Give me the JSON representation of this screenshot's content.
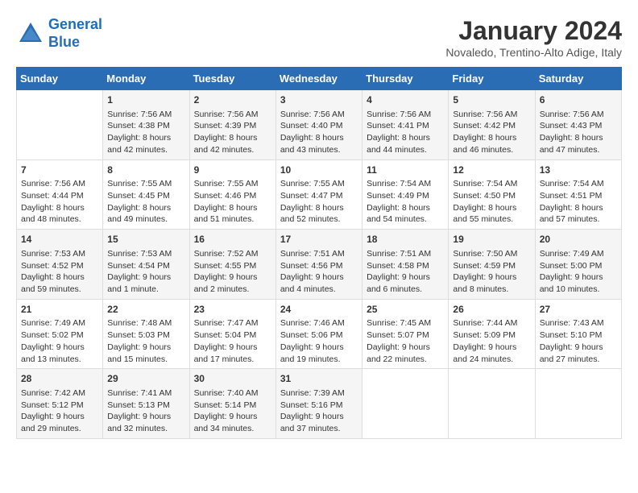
{
  "header": {
    "logo_line1": "General",
    "logo_line2": "Blue",
    "month_year": "January 2024",
    "location": "Novaledo, Trentino-Alto Adige, Italy"
  },
  "days_of_week": [
    "Sunday",
    "Monday",
    "Tuesday",
    "Wednesday",
    "Thursday",
    "Friday",
    "Saturday"
  ],
  "weeks": [
    [
      {
        "day": "",
        "sunrise": "",
        "sunset": "",
        "daylight": ""
      },
      {
        "day": "1",
        "sunrise": "Sunrise: 7:56 AM",
        "sunset": "Sunset: 4:38 PM",
        "daylight": "Daylight: 8 hours and 42 minutes."
      },
      {
        "day": "2",
        "sunrise": "Sunrise: 7:56 AM",
        "sunset": "Sunset: 4:39 PM",
        "daylight": "Daylight: 8 hours and 42 minutes."
      },
      {
        "day": "3",
        "sunrise": "Sunrise: 7:56 AM",
        "sunset": "Sunset: 4:40 PM",
        "daylight": "Daylight: 8 hours and 43 minutes."
      },
      {
        "day": "4",
        "sunrise": "Sunrise: 7:56 AM",
        "sunset": "Sunset: 4:41 PM",
        "daylight": "Daylight: 8 hours and 44 minutes."
      },
      {
        "day": "5",
        "sunrise": "Sunrise: 7:56 AM",
        "sunset": "Sunset: 4:42 PM",
        "daylight": "Daylight: 8 hours and 46 minutes."
      },
      {
        "day": "6",
        "sunrise": "Sunrise: 7:56 AM",
        "sunset": "Sunset: 4:43 PM",
        "daylight": "Daylight: 8 hours and 47 minutes."
      }
    ],
    [
      {
        "day": "7",
        "sunrise": "Sunrise: 7:56 AM",
        "sunset": "Sunset: 4:44 PM",
        "daylight": "Daylight: 8 hours and 48 minutes."
      },
      {
        "day": "8",
        "sunrise": "Sunrise: 7:55 AM",
        "sunset": "Sunset: 4:45 PM",
        "daylight": "Daylight: 8 hours and 49 minutes."
      },
      {
        "day": "9",
        "sunrise": "Sunrise: 7:55 AM",
        "sunset": "Sunset: 4:46 PM",
        "daylight": "Daylight: 8 hours and 51 minutes."
      },
      {
        "day": "10",
        "sunrise": "Sunrise: 7:55 AM",
        "sunset": "Sunset: 4:47 PM",
        "daylight": "Daylight: 8 hours and 52 minutes."
      },
      {
        "day": "11",
        "sunrise": "Sunrise: 7:54 AM",
        "sunset": "Sunset: 4:49 PM",
        "daylight": "Daylight: 8 hours and 54 minutes."
      },
      {
        "day": "12",
        "sunrise": "Sunrise: 7:54 AM",
        "sunset": "Sunset: 4:50 PM",
        "daylight": "Daylight: 8 hours and 55 minutes."
      },
      {
        "day": "13",
        "sunrise": "Sunrise: 7:54 AM",
        "sunset": "Sunset: 4:51 PM",
        "daylight": "Daylight: 8 hours and 57 minutes."
      }
    ],
    [
      {
        "day": "14",
        "sunrise": "Sunrise: 7:53 AM",
        "sunset": "Sunset: 4:52 PM",
        "daylight": "Daylight: 8 hours and 59 minutes."
      },
      {
        "day": "15",
        "sunrise": "Sunrise: 7:53 AM",
        "sunset": "Sunset: 4:54 PM",
        "daylight": "Daylight: 9 hours and 1 minute."
      },
      {
        "day": "16",
        "sunrise": "Sunrise: 7:52 AM",
        "sunset": "Sunset: 4:55 PM",
        "daylight": "Daylight: 9 hours and 2 minutes."
      },
      {
        "day": "17",
        "sunrise": "Sunrise: 7:51 AM",
        "sunset": "Sunset: 4:56 PM",
        "daylight": "Daylight: 9 hours and 4 minutes."
      },
      {
        "day": "18",
        "sunrise": "Sunrise: 7:51 AM",
        "sunset": "Sunset: 4:58 PM",
        "daylight": "Daylight: 9 hours and 6 minutes."
      },
      {
        "day": "19",
        "sunrise": "Sunrise: 7:50 AM",
        "sunset": "Sunset: 4:59 PM",
        "daylight": "Daylight: 9 hours and 8 minutes."
      },
      {
        "day": "20",
        "sunrise": "Sunrise: 7:49 AM",
        "sunset": "Sunset: 5:00 PM",
        "daylight": "Daylight: 9 hours and 10 minutes."
      }
    ],
    [
      {
        "day": "21",
        "sunrise": "Sunrise: 7:49 AM",
        "sunset": "Sunset: 5:02 PM",
        "daylight": "Daylight: 9 hours and 13 minutes."
      },
      {
        "day": "22",
        "sunrise": "Sunrise: 7:48 AM",
        "sunset": "Sunset: 5:03 PM",
        "daylight": "Daylight: 9 hours and 15 minutes."
      },
      {
        "day": "23",
        "sunrise": "Sunrise: 7:47 AM",
        "sunset": "Sunset: 5:04 PM",
        "daylight": "Daylight: 9 hours and 17 minutes."
      },
      {
        "day": "24",
        "sunrise": "Sunrise: 7:46 AM",
        "sunset": "Sunset: 5:06 PM",
        "daylight": "Daylight: 9 hours and 19 minutes."
      },
      {
        "day": "25",
        "sunrise": "Sunrise: 7:45 AM",
        "sunset": "Sunset: 5:07 PM",
        "daylight": "Daylight: 9 hours and 22 minutes."
      },
      {
        "day": "26",
        "sunrise": "Sunrise: 7:44 AM",
        "sunset": "Sunset: 5:09 PM",
        "daylight": "Daylight: 9 hours and 24 minutes."
      },
      {
        "day": "27",
        "sunrise": "Sunrise: 7:43 AM",
        "sunset": "Sunset: 5:10 PM",
        "daylight": "Daylight: 9 hours and 27 minutes."
      }
    ],
    [
      {
        "day": "28",
        "sunrise": "Sunrise: 7:42 AM",
        "sunset": "Sunset: 5:12 PM",
        "daylight": "Daylight: 9 hours and 29 minutes."
      },
      {
        "day": "29",
        "sunrise": "Sunrise: 7:41 AM",
        "sunset": "Sunset: 5:13 PM",
        "daylight": "Daylight: 9 hours and 32 minutes."
      },
      {
        "day": "30",
        "sunrise": "Sunrise: 7:40 AM",
        "sunset": "Sunset: 5:14 PM",
        "daylight": "Daylight: 9 hours and 34 minutes."
      },
      {
        "day": "31",
        "sunrise": "Sunrise: 7:39 AM",
        "sunset": "Sunset: 5:16 PM",
        "daylight": "Daylight: 9 hours and 37 minutes."
      },
      {
        "day": "",
        "sunrise": "",
        "sunset": "",
        "daylight": ""
      },
      {
        "day": "",
        "sunrise": "",
        "sunset": "",
        "daylight": ""
      },
      {
        "day": "",
        "sunrise": "",
        "sunset": "",
        "daylight": ""
      }
    ]
  ]
}
